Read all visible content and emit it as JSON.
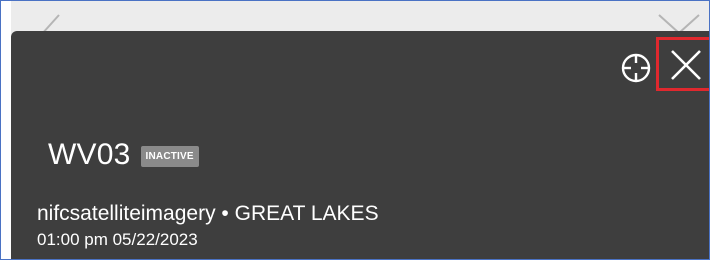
{
  "panel": {
    "title": "WV03",
    "status_badge": "INACTIVE",
    "source": "nifcsatelliteimagery",
    "separator": "•",
    "region": "GREAT LAKES",
    "timestamp": "01:00 pm 05/22/2023"
  },
  "icons": {
    "locate": "crosshair-target-icon",
    "close": "close-x-icon"
  },
  "colors": {
    "panel_background": "#3e3e3e",
    "badge_background": "#8a8a8a",
    "highlight_border": "#e0282e",
    "text": "#ffffff"
  }
}
